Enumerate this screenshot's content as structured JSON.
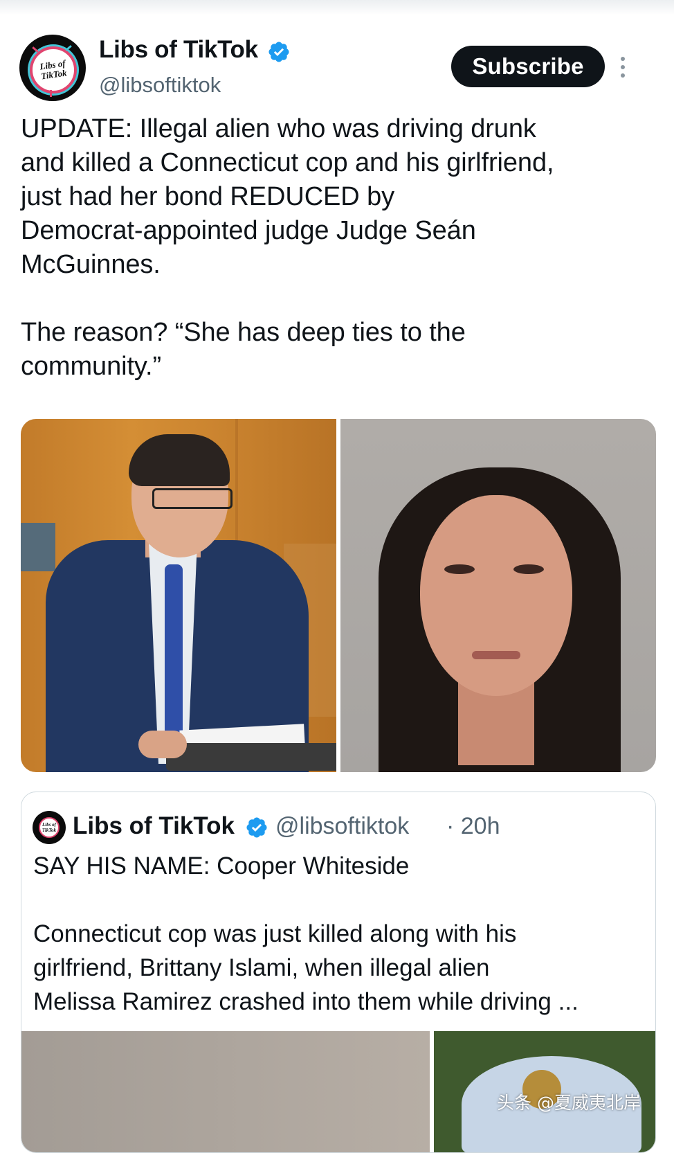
{
  "post": {
    "author": {
      "name": "Libs of TikTok",
      "handle": "@libsoftiktok",
      "avatar_text_line1": "Libs of",
      "avatar_text_line2": "TikTok",
      "verified": true
    },
    "subscribe_label": "Subscribe",
    "more_icon": "more-vertical-icon",
    "text": "UPDATE: Illegal alien who was driving drunk\nand killed a Connecticut cop and his girlfriend,\njust had her bond REDUCED by\nDemocrat-appointed judge Judge Seán\nMcGuinnes.\n\nThe reason? “She has deep ties to the\ncommunity.”"
  },
  "quoted_post": {
    "author": {
      "name": "Libs of TikTok",
      "handle": "@libsoftiktok",
      "avatar_text": "Libs of TikTok",
      "verified": true
    },
    "time": "· 20h",
    "text": "SAY HIS NAME: Cooper Whiteside\n\nConnecticut cop was just killed along with his\ngirlfriend, Brittany Islami, when illegal alien\nMelissa Ramirez crashed into them while driving ..."
  },
  "watermark": "头条 @夏威夷北岸",
  "colors": {
    "verified_blue": "#1d9bf0",
    "secondary_text": "#536471",
    "button_bg": "#0f1419",
    "border": "#cfd9de"
  }
}
